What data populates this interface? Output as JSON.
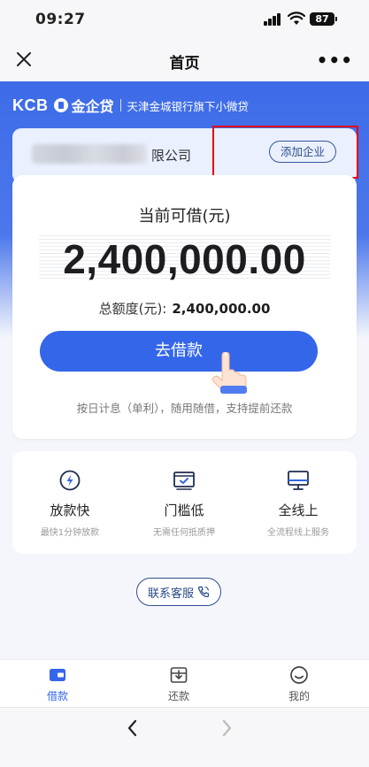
{
  "status_bar": {
    "time": "09:27",
    "battery": "87"
  },
  "nav": {
    "title": "首页",
    "more": "•••"
  },
  "brand": {
    "kcb": "KCB",
    "name": "金企贷",
    "subtitle": "天津金城银行旗下小微贷"
  },
  "company": {
    "name_visible": "限公司",
    "add_button": "添加企业"
  },
  "loan": {
    "title": "当前可借(元)",
    "amount": "2,400,000.00",
    "total_label": "总额度(元):",
    "total_value": "2,400,000.00",
    "borrow_button": "去借款",
    "note": "按日计息（单利），随用随借，支持提前还款"
  },
  "features": [
    {
      "icon": "lightning-icon",
      "title": "放款快",
      "desc": "最快1分钟放款"
    },
    {
      "icon": "envelope-check-icon",
      "title": "门槛低",
      "desc": "无需任何抵质押"
    },
    {
      "icon": "monitor-icon",
      "title": "全线上",
      "desc": "全流程线上服务"
    }
  ],
  "service_button": "联系客服",
  "tabs": [
    {
      "label": "借款",
      "icon": "wallet-icon",
      "active": true
    },
    {
      "label": "还款",
      "icon": "repay-icon",
      "active": false
    },
    {
      "label": "我的",
      "icon": "smile-icon",
      "active": false
    }
  ],
  "colors": {
    "primary": "#3466EA",
    "highlight": "#E60012",
    "hero": "#3D6BE8"
  }
}
